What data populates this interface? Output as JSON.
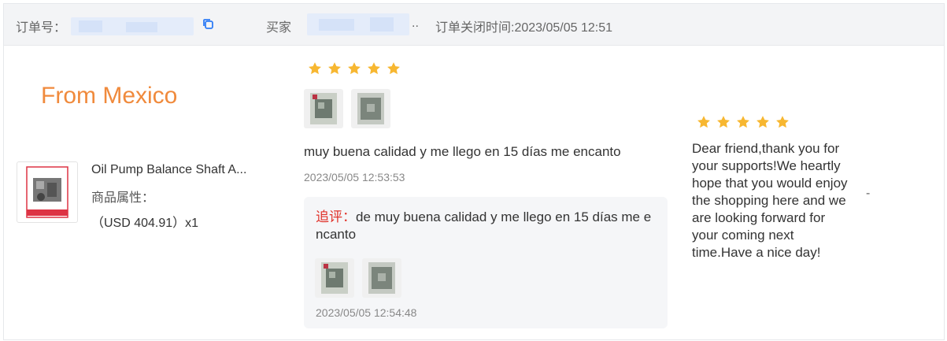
{
  "header": {
    "order_no_label": "订单号：",
    "buyer_label": "买家",
    "buyer_ellipsis": "..",
    "close_time_label": "订单关闭时间:2023/05/05 12:51"
  },
  "product": {
    "origin": "From Mexico",
    "title": "Oil Pump Balance Shaft A...",
    "attr_label": "商品属性：",
    "price": "（USD 404.91）x1"
  },
  "review": {
    "rating": 5,
    "text": "muy buena calidad y me llego en 15 días me encanto",
    "time": "2023/05/05 12:53:53",
    "image_count": 2
  },
  "followup": {
    "tag": "追评：",
    "text": "de muy buena calidad y me llego en 15 días me encanto",
    "time": "2023/05/05 12:54:48",
    "image_count": 2
  },
  "seller_reply": {
    "rating": 5,
    "text": "Dear friend,thank you for your supports!We heartly hope that you would enjoy the shopping here and we are looking forward for your coming next time.Have a nice day!"
  },
  "action_placeholder": "-",
  "colors": {
    "star": "#f7b731",
    "origin": "#f08a3c",
    "followup_tag": "#e0322a",
    "copy_icon": "#2f7cf6"
  }
}
